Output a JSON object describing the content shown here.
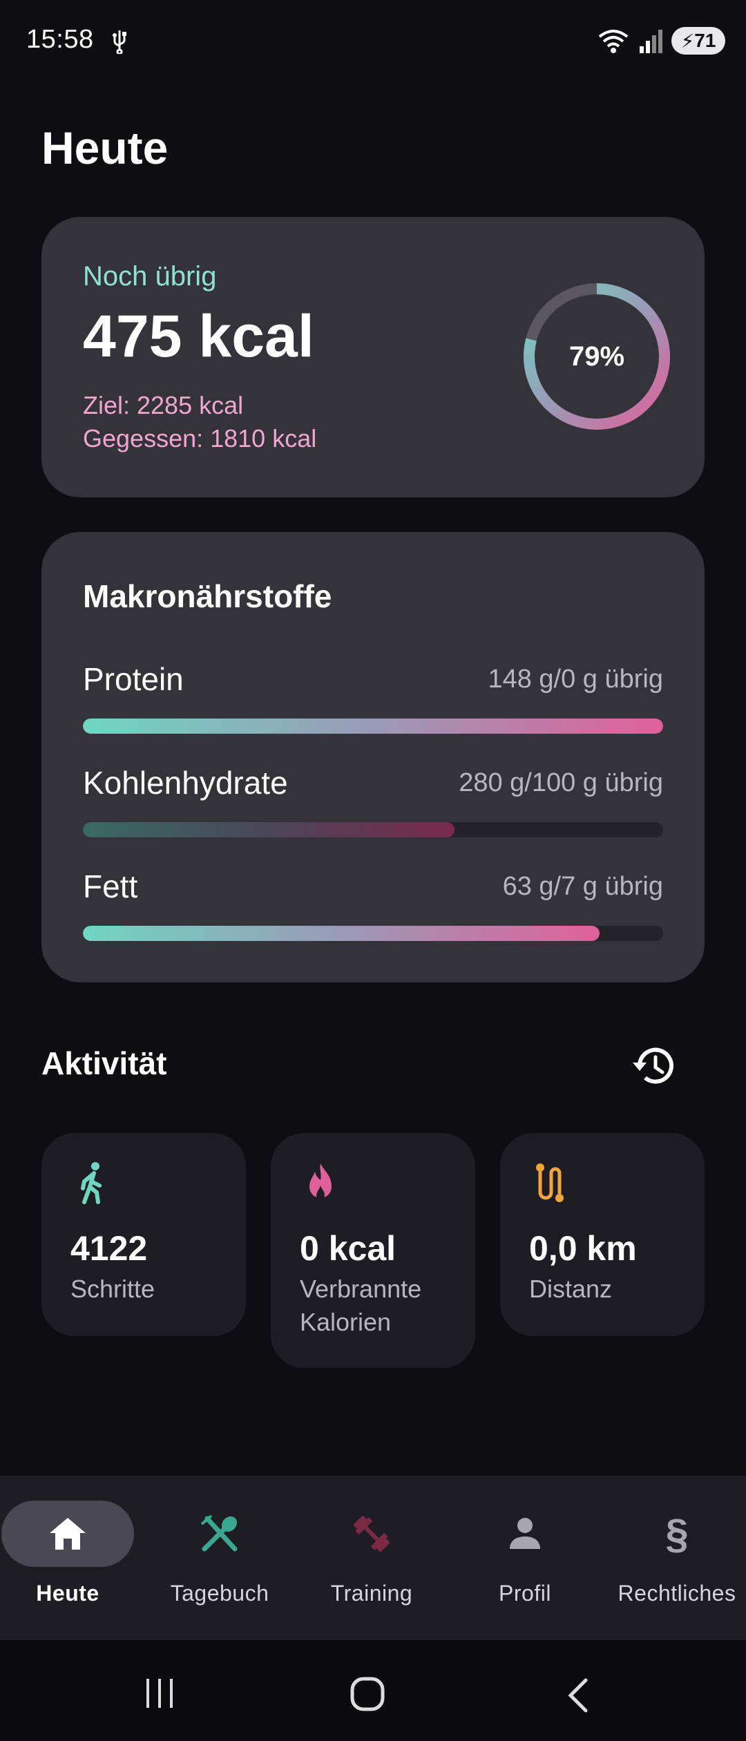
{
  "status": {
    "time": "15:58",
    "battery": "71"
  },
  "page": {
    "title": "Heute"
  },
  "calories": {
    "remaining_label": "Noch übrig",
    "remaining_value": "475 kcal",
    "goal_text": "Ziel: 2285 kcal",
    "eaten_text": "Gegessen: 1810 kcal",
    "percent_label": "79%",
    "percent": 0.79
  },
  "macros": {
    "title": "Makronährstoffe",
    "items": [
      {
        "name": "Protein",
        "info": "148 g/0 g übrig",
        "progress": 1.0
      },
      {
        "name": "Kohlenhydrate",
        "info": "280 g/100 g übrig",
        "progress": 0.64
      },
      {
        "name": "Fett",
        "info": "63 g/7 g übrig",
        "progress": 0.89
      }
    ]
  },
  "activity": {
    "title": "Aktivität",
    "cards": [
      {
        "value": "4122",
        "label": "Schritte",
        "icon": "walk-icon",
        "color": "#6fd6c2"
      },
      {
        "value": "0 kcal",
        "label": "Verbrannte Kalorien",
        "icon": "fire-icon",
        "color": "#e0609a"
      },
      {
        "value": "0,0 km",
        "label": "Distanz",
        "icon": "route-icon",
        "color": "#f0a63a"
      }
    ]
  },
  "nav": {
    "items": [
      {
        "label": "Heute",
        "icon": "home-icon",
        "active": true
      },
      {
        "label": "Tagebuch",
        "icon": "utensils-icon",
        "active": false
      },
      {
        "label": "Training",
        "icon": "dumbbell-icon",
        "active": false
      },
      {
        "label": "Profil",
        "icon": "person-icon",
        "active": false
      },
      {
        "label": "Rechtliches",
        "icon": "paragraph-icon",
        "active": false
      }
    ]
  },
  "colors": {
    "accent_teal": "#6fd6c2",
    "accent_pink": "#e0609a",
    "accent_orange": "#f0a63a",
    "card_bg": "#35333a",
    "background": "#0d0d12"
  }
}
